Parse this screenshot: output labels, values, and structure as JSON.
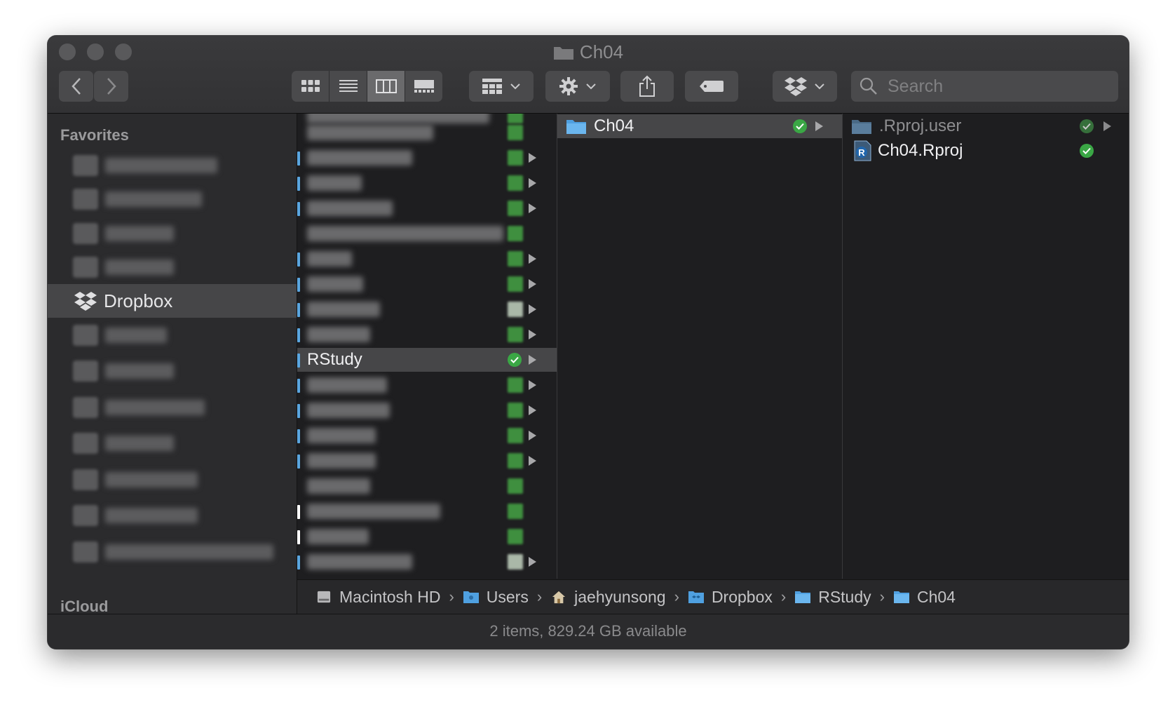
{
  "window": {
    "title": "Ch04"
  },
  "toolbar": {
    "back_label": "Back",
    "forward_label": "Forward",
    "view_modes": [
      "icon-view",
      "list-view",
      "column-view",
      "gallery-view"
    ],
    "active_view": "column-view",
    "search_placeholder": "Search"
  },
  "sidebar": {
    "favorites_heading": "Favorites",
    "selected_item": "Dropbox",
    "icloud_heading": "iCloud"
  },
  "column1": {
    "selected_label": "RStudy"
  },
  "column2": {
    "items": [
      {
        "label": "Ch04"
      }
    ]
  },
  "column3": {
    "items": [
      {
        "label": ".Rproj.user",
        "kind": "folder"
      },
      {
        "label": "Ch04.Rproj",
        "kind": "rproj"
      }
    ]
  },
  "pathbar": {
    "crumbs": [
      "Macintosh HD",
      "Users",
      "jaehyunsong",
      "Dropbox",
      "RStudy",
      "Ch04"
    ]
  },
  "status": {
    "text": "2 items, 829.24 GB available"
  },
  "colors": {
    "accent_blue": "#5aa6e0",
    "sync_green": "#3aa745",
    "selection_gray": "#464648"
  }
}
